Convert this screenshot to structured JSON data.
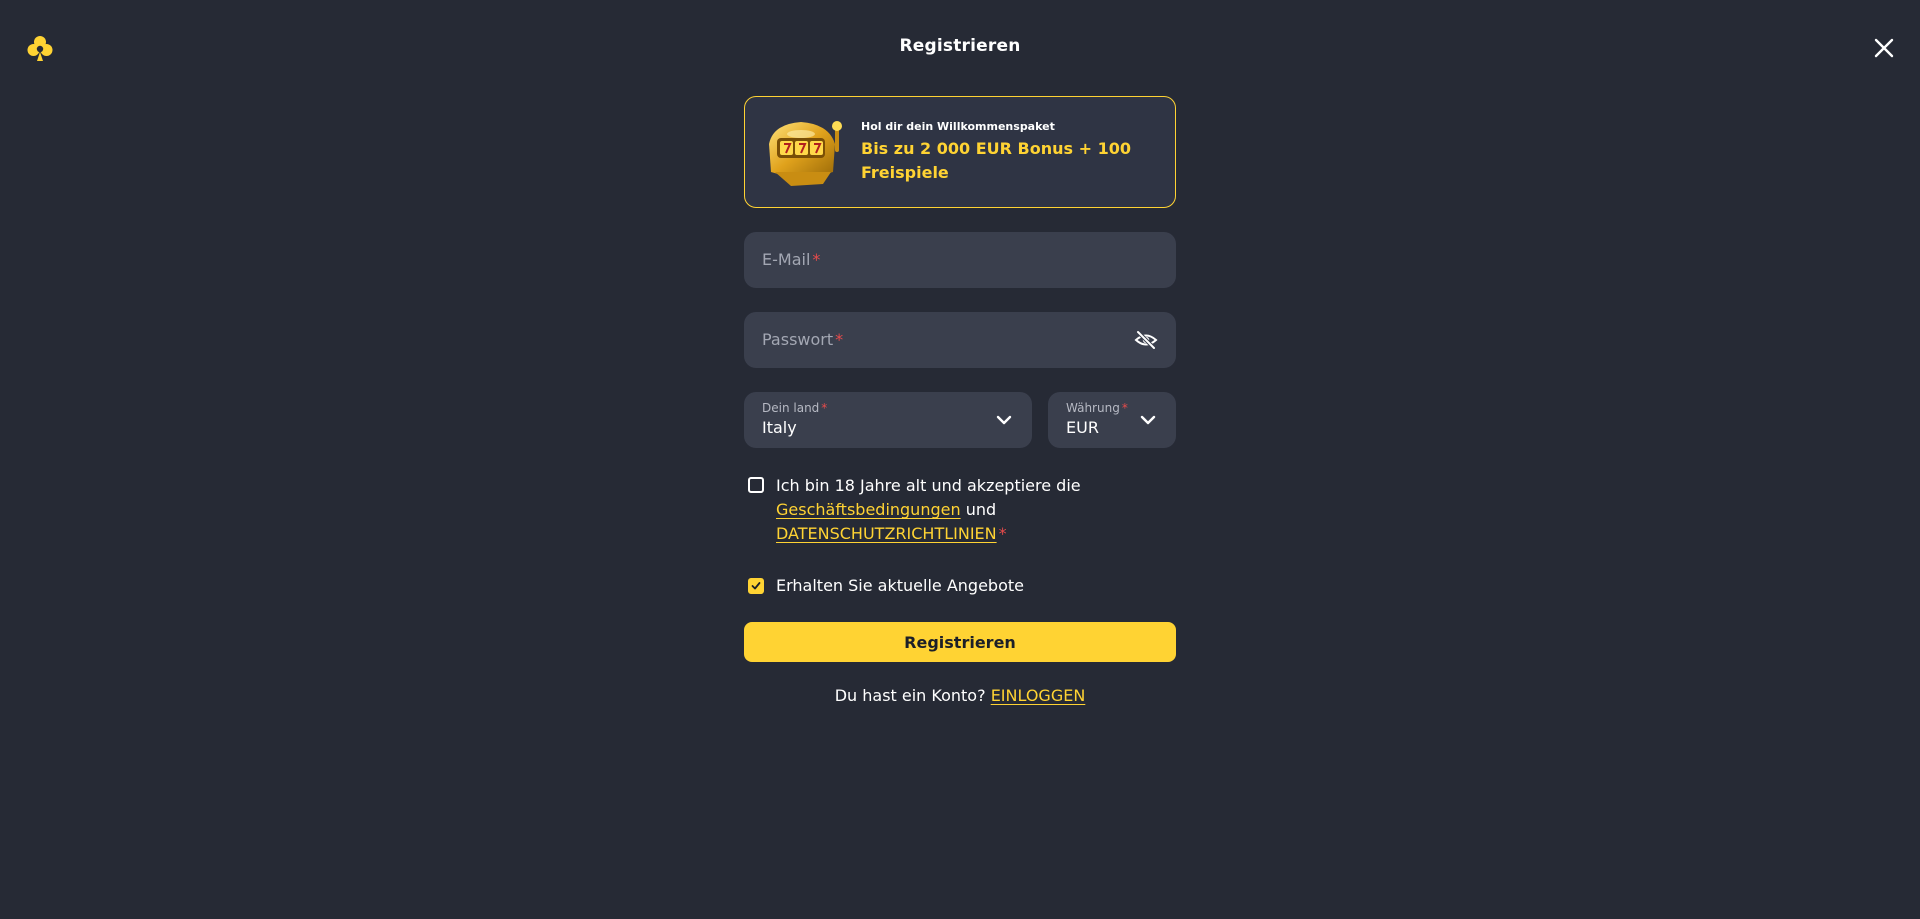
{
  "header": {
    "title": "Registrieren",
    "logo_icon": "club-icon",
    "close_icon": "close-icon"
  },
  "promo": {
    "subtitle": "Hol dir dein Willkommenspaket",
    "headline": "Bis zu 2 000 EUR Bonus + 100 Freispiele",
    "image_icon": "slot-machine-icon"
  },
  "form": {
    "email_placeholder": "E-Mail",
    "password_placeholder": "Passwort",
    "required_mark": "*",
    "country_label": "Dein land",
    "country_value": "Italy",
    "currency_label": "Währung",
    "currency_value": "EUR",
    "terms": {
      "text_before": "Ich bin 18 Jahre alt und akzeptiere die",
      "terms_link": "Geschäftsbedingungen",
      "text_middle": "und",
      "privacy_link": "DATENSCHUTZRICHTLINIEN",
      "checked": false
    },
    "offers": {
      "label": "Erhalten Sie aktuelle Angebote",
      "checked": true
    },
    "submit_label": "Registrieren",
    "login_prompt": "Du hast ein Konto?",
    "login_link": "EINLOGGEN"
  },
  "colors": {
    "background": "#262a35",
    "field": "#3a3f4d",
    "accent": "#ffd333",
    "required": "#e84b4b"
  }
}
